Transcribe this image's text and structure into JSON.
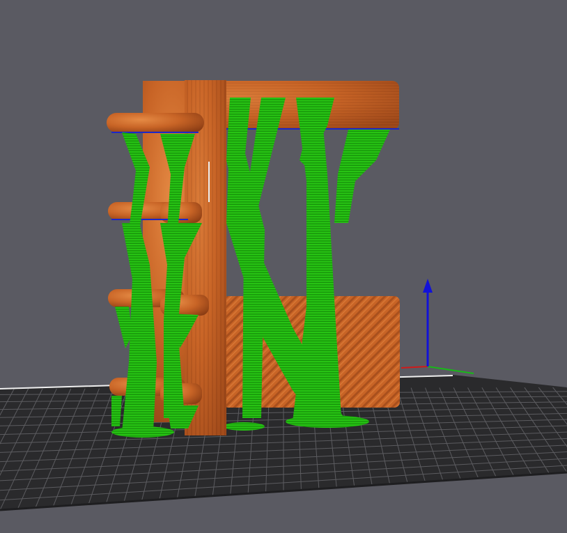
{
  "viewport": {
    "background_color": "#5a5a62"
  },
  "bed": {
    "fill_color": "#2a2a2c",
    "grid_color": "#5c5c60",
    "edge_color": "#1e1e20",
    "highlight_edge_color": "#f0f0f0"
  },
  "model": {
    "part_color": "#c86426",
    "part_dark_color": "#8a3c14",
    "part_light_color": "#e58a44",
    "support_color": "#27c414",
    "support_dark_color": "#128406",
    "interface_color": "#1b27c8"
  },
  "axes": {
    "x_color": "#d01a1a",
    "y_color": "#18b818",
    "z_color": "#1212d8"
  },
  "icons": {
    "z_axis": "arrow-up-icon"
  }
}
